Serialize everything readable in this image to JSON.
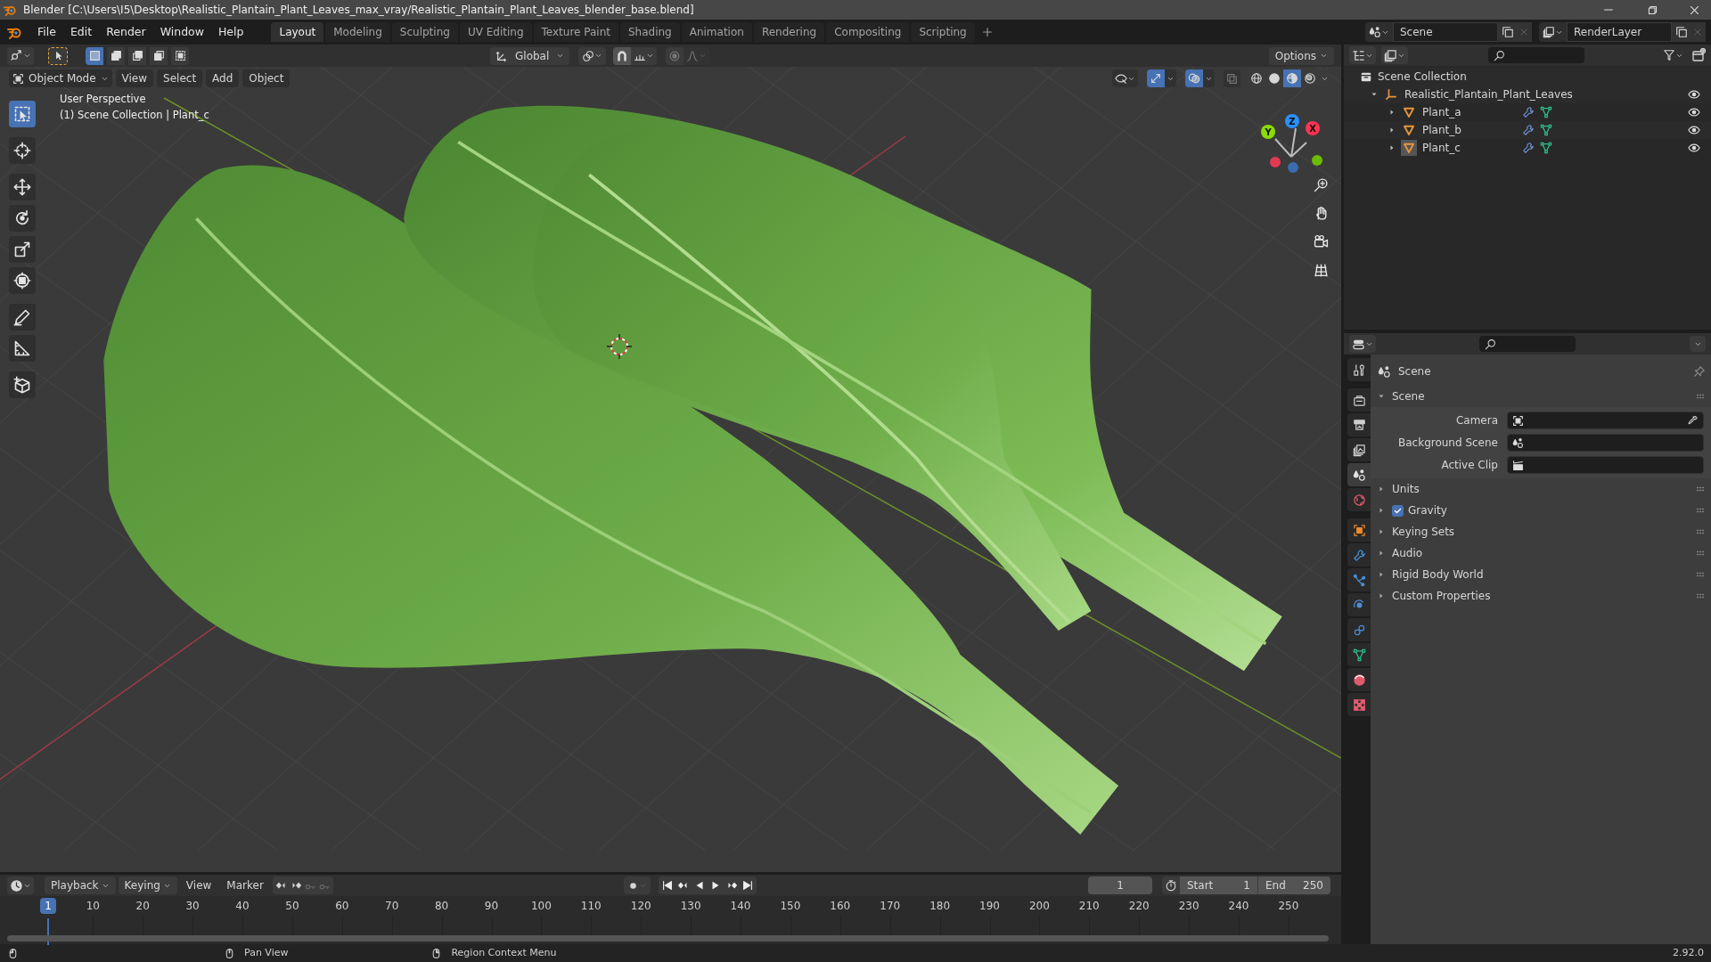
{
  "window": {
    "title": "Blender [C:\\Users\\I5\\Desktop\\Realistic_Plantain_Plant_Leaves_max_vray/Realistic_Plantain_Plant_Leaves_blender_base.blend]"
  },
  "menu": [
    "File",
    "Edit",
    "Render",
    "Window",
    "Help"
  ],
  "workspace_tabs": [
    {
      "label": "Layout",
      "selected": true
    },
    {
      "label": "Modeling",
      "selected": false
    },
    {
      "label": "Sculpting",
      "selected": false
    },
    {
      "label": "UV Editing",
      "selected": false
    },
    {
      "label": "Texture Paint",
      "selected": false
    },
    {
      "label": "Shading",
      "selected": false
    },
    {
      "label": "Animation",
      "selected": false
    },
    {
      "label": "Rendering",
      "selected": false
    },
    {
      "label": "Compositing",
      "selected": false
    },
    {
      "label": "Scripting",
      "selected": false
    }
  ],
  "scene_selector": {
    "value": "Scene"
  },
  "view_layer_selector": {
    "value": "RenderLayer"
  },
  "viewport": {
    "orientation": "Global",
    "options": "Options",
    "mode": "Object Mode",
    "menus": [
      "View",
      "Select",
      "Add",
      "Object"
    ],
    "select_modes": [
      {
        "kind": "set",
        "selected": true
      },
      {
        "kind": "extend",
        "selected": false
      },
      {
        "kind": "subtract",
        "selected": false
      },
      {
        "kind": "invert",
        "selected": false
      },
      {
        "kind": "intersect",
        "selected": false
      }
    ],
    "tools": [
      {
        "kind": "select",
        "selected": true
      },
      {
        "kind": "cursor",
        "selected": false
      },
      {
        "kind": "move",
        "selected": false
      },
      {
        "kind": "rotate",
        "selected": false
      },
      {
        "kind": "scale",
        "selected": false
      },
      {
        "kind": "transform",
        "selected": false
      },
      {
        "kind": "annotate",
        "selected": false
      },
      {
        "kind": "measure",
        "selected": false
      },
      {
        "kind": "add_cube",
        "selected": false
      }
    ],
    "gizmos_on": true,
    "overlays_on": true,
    "shading_modes": [
      {
        "kind": "wireframe",
        "selected": false
      },
      {
        "kind": "solid",
        "selected": false
      },
      {
        "kind": "material",
        "selected": true
      },
      {
        "kind": "rendered",
        "selected": false
      }
    ],
    "info": [
      "User Perspective",
      "(1) Scene Collection | Plant_c"
    ],
    "gizmo_axes": [
      {
        "label": "Y",
        "color": "#8bdc00"
      },
      {
        "label": "Z",
        "color": "#2890ff"
      },
      {
        "label": "X",
        "color": "#ff3352"
      }
    ]
  },
  "outliner": {
    "root": "Scene Collection",
    "items": [
      {
        "label": "Realistic_Plantain_Plant_Leaves",
        "kind": "empty",
        "expanded": true,
        "active": false,
        "children": [
          {
            "label": "Plant_a",
            "kind": "mesh",
            "expanded": false,
            "active": false
          },
          {
            "label": "Plant_b",
            "kind": "mesh",
            "expanded": false,
            "active": false
          },
          {
            "label": "Plant_c",
            "kind": "mesh",
            "expanded": false,
            "active": true
          }
        ]
      }
    ]
  },
  "properties": {
    "tabs": [
      {
        "kind": "tool",
        "selected": false
      },
      {
        "kind": "render",
        "selected": false
      },
      {
        "kind": "output",
        "selected": false
      },
      {
        "kind": "view_layer",
        "selected": false
      },
      {
        "kind": "scene",
        "selected": true
      },
      {
        "kind": "world",
        "selected": false
      },
      {
        "kind": "object",
        "selected": false
      },
      {
        "kind": "modifiers",
        "selected": false
      },
      {
        "kind": "particles",
        "selected": false
      },
      {
        "kind": "physics",
        "selected": false
      },
      {
        "kind": "constraints",
        "selected": false
      },
      {
        "kind": "data",
        "selected": false
      },
      {
        "kind": "material",
        "selected": false
      },
      {
        "kind": "texture",
        "selected": false
      }
    ],
    "context": "Scene",
    "panel": {
      "label": "Scene",
      "expanded": true,
      "fields": [
        {
          "label": "Camera",
          "kind": "camera"
        },
        {
          "label": "Background Scene",
          "kind": "scene"
        },
        {
          "label": "Active Clip",
          "kind": "clip"
        }
      ]
    },
    "subpanels": [
      {
        "label": "Units",
        "kind": "panel",
        "expanded": false
      },
      {
        "label": "Gravity",
        "kind": "checkbox",
        "expanded": false,
        "checked": true
      },
      {
        "label": "Keying Sets",
        "kind": "panel",
        "expanded": false
      },
      {
        "label": "Audio",
        "kind": "panel",
        "expanded": false
      },
      {
        "label": "Rigid Body World",
        "kind": "panel",
        "expanded": false
      },
      {
        "label": "Custom Properties",
        "kind": "panel",
        "expanded": false
      }
    ]
  },
  "timeline": {
    "menus": [
      "Playback",
      "Keying",
      "View",
      "Marker"
    ],
    "current_frame": "1",
    "start_label": "Start",
    "start": "1",
    "end_label": "End",
    "end": "250",
    "ticks": [
      {
        "label": "1",
        "selected": true
      },
      {
        "label": "10",
        "selected": false
      },
      {
        "label": "20",
        "selected": false
      },
      {
        "label": "30",
        "selected": false
      },
      {
        "label": "40",
        "selected": false
      },
      {
        "label": "50",
        "selected": false
      },
      {
        "label": "60",
        "selected": false
      },
      {
        "label": "70",
        "selected": false
      },
      {
        "label": "80",
        "selected": false
      },
      {
        "label": "90",
        "selected": false
      },
      {
        "label": "100",
        "selected": false
      },
      {
        "label": "110",
        "selected": false
      },
      {
        "label": "120",
        "selected": false
      },
      {
        "label": "130",
        "selected": false
      },
      {
        "label": "140",
        "selected": false
      },
      {
        "label": "150",
        "selected": false
      },
      {
        "label": "160",
        "selected": false
      },
      {
        "label": "170",
        "selected": false
      },
      {
        "label": "180",
        "selected": false
      },
      {
        "label": "190",
        "selected": false
      },
      {
        "label": "200",
        "selected": false
      },
      {
        "label": "210",
        "selected": false
      },
      {
        "label": "220",
        "selected": false
      },
      {
        "label": "230",
        "selected": false
      },
      {
        "label": "240",
        "selected": false
      },
      {
        "label": "250",
        "selected": false
      }
    ]
  },
  "status_bar": {
    "hints": [
      "Pan View",
      "Region Context Menu"
    ],
    "version": "2.92.0"
  }
}
